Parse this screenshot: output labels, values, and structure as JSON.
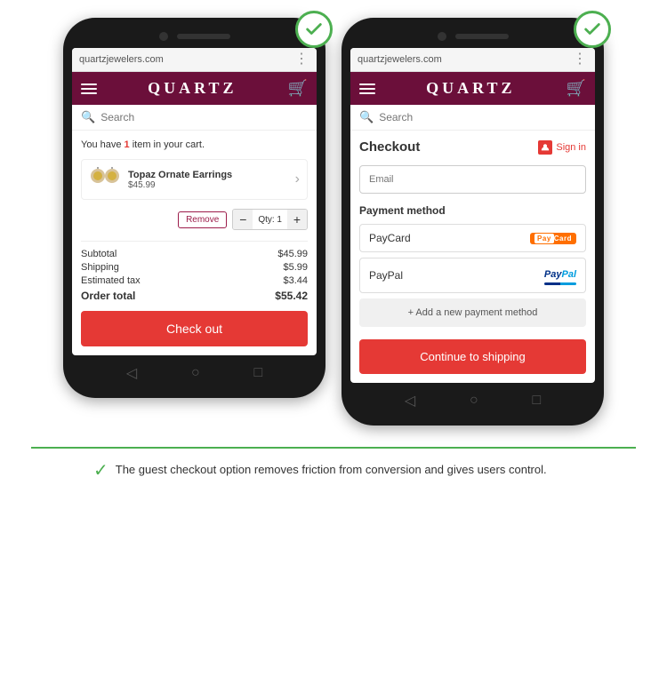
{
  "phone1": {
    "browser_url": "quartzjewelers.com",
    "logo": "QUARTZ",
    "search_placeholder": "Search",
    "cart_notice": "You have ",
    "cart_notice_count": "1",
    "cart_notice_suffix": " item in your cart.",
    "item_name": "Topaz Ornate Earrings",
    "item_price": "$45.99",
    "remove_label": "Remove",
    "qty_label": "Qty: 1",
    "subtotal_label": "Subtotal",
    "subtotal_value": "$45.99",
    "shipping_label": "Shipping",
    "shipping_value": "$5.99",
    "tax_label": "Estimated tax",
    "tax_value": "$3.44",
    "order_total_label": "Order total",
    "order_total_value": "$55.42",
    "checkout_btn": "Check out"
  },
  "phone2": {
    "browser_url": "quartzjewelers.com",
    "logo": "QUARTZ",
    "search_placeholder": "Search",
    "checkout_title": "Checkout",
    "signin_label": "Sign in",
    "email_placeholder": "Email",
    "payment_label": "Payment method",
    "payment1_name": "PayCard",
    "payment1_badge": "PayCard",
    "payment2_name": "PayPal",
    "payment2_blue": "Pay",
    "payment2_sky": "Pal",
    "add_payment_label": "+ Add a new payment method",
    "continue_btn": "Continue to shipping"
  },
  "footnote": {
    "text": "The guest checkout option removes friction from conversion and gives users control."
  }
}
